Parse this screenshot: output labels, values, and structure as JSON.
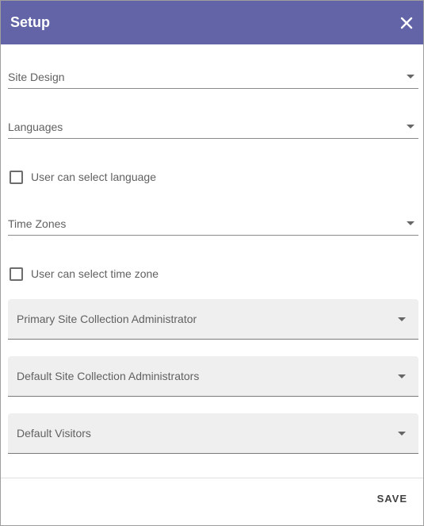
{
  "header": {
    "title": "Setup",
    "background": "#6264a7"
  },
  "fields": {
    "site_design": {
      "label": "Site Design"
    },
    "languages": {
      "label": "Languages"
    },
    "user_select_language": {
      "label": "User can select language",
      "checked": false
    },
    "time_zones": {
      "label": "Time Zones"
    },
    "user_select_time_zone": {
      "label": "User can select time zone",
      "checked": false
    },
    "primary_admin": {
      "label": "Primary Site Collection Administrator"
    },
    "default_admins": {
      "label": "Default Site Collection Administrators"
    },
    "default_visitors": {
      "label": "Default Visitors"
    }
  },
  "footer": {
    "save_label": "SAVE"
  },
  "icons": {
    "close": "close-icon",
    "dropdown": "chevron-down-icon"
  }
}
